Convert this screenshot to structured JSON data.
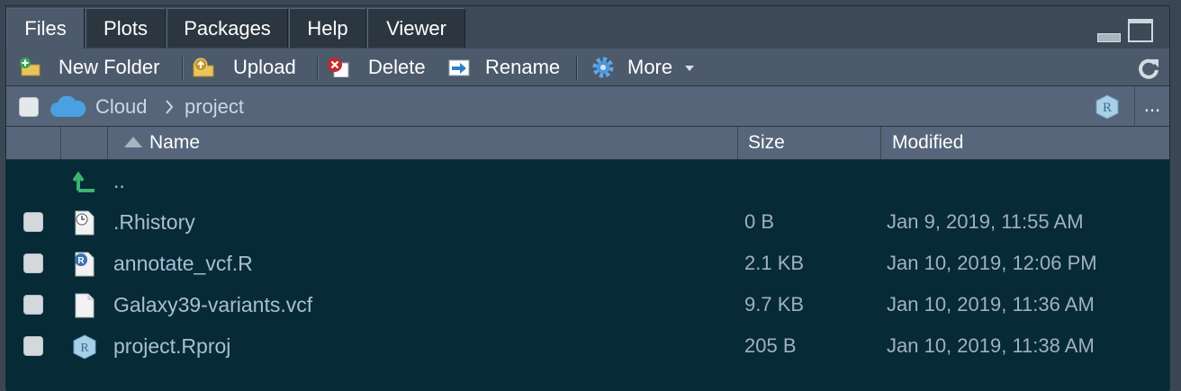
{
  "tabs": [
    "Files",
    "Plots",
    "Packages",
    "Help",
    "Viewer"
  ],
  "toolbar": {
    "new_folder": "New Folder",
    "upload": "Upload",
    "delete": "Delete",
    "rename": "Rename",
    "more": "More"
  },
  "path": {
    "root": "Cloud",
    "current": "project",
    "more": "..."
  },
  "columns": {
    "name": "Name",
    "size": "Size",
    "modified": "Modified"
  },
  "parent_label": "..",
  "files": [
    {
      "name": ".Rhistory",
      "size": "0 B",
      "modified": "Jan 9, 2019, 11:55 AM",
      "icon": "history-file-icon"
    },
    {
      "name": "annotate_vcf.R",
      "size": "2.1 KB",
      "modified": "Jan 10, 2019, 12:06 PM",
      "icon": "r-script-icon"
    },
    {
      "name": "Galaxy39-variants.vcf",
      "size": "9.7 KB",
      "modified": "Jan 10, 2019, 11:36 AM",
      "icon": "file-icon"
    },
    {
      "name": "project.Rproj",
      "size": "205 B",
      "modified": "Jan 10, 2019, 11:38 AM",
      "icon": "rproj-icon"
    }
  ],
  "colors": {
    "list_background": "#062a36",
    "file_name": "#a9bed6",
    "accent_green": "#3cb371"
  }
}
